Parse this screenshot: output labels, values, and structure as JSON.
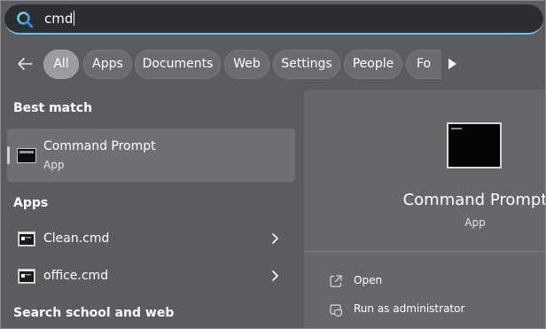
{
  "search": {
    "query": "cmd"
  },
  "filters": [
    "All",
    "Apps",
    "Documents",
    "Web",
    "Settings",
    "People",
    "Fo"
  ],
  "colors": {
    "accent": "#66c1e8",
    "background": "#5b5c5f",
    "searchbar": "#2d2e31"
  },
  "icons": {
    "search": "search-icon",
    "back": "arrow-left-icon",
    "more": "play-right-icon",
    "app": "command-prompt-icon",
    "script": "cmd-file-icon",
    "chevron": "chevron-right-icon",
    "open": "open-external-icon",
    "admin": "shield-run-as-admin-icon"
  },
  "best_match": {
    "heading": "Best match",
    "title": "Command Prompt",
    "subtitle": "App"
  },
  "apps": {
    "heading": "Apps",
    "items": [
      {
        "label": "Clean.cmd"
      },
      {
        "label": "office.cmd"
      }
    ]
  },
  "search_web": {
    "heading": "Search school and web"
  },
  "detail": {
    "title": "Command Prompt",
    "subtitle": "App",
    "actions": [
      {
        "label": "Open"
      },
      {
        "label": "Run as administrator"
      }
    ]
  }
}
